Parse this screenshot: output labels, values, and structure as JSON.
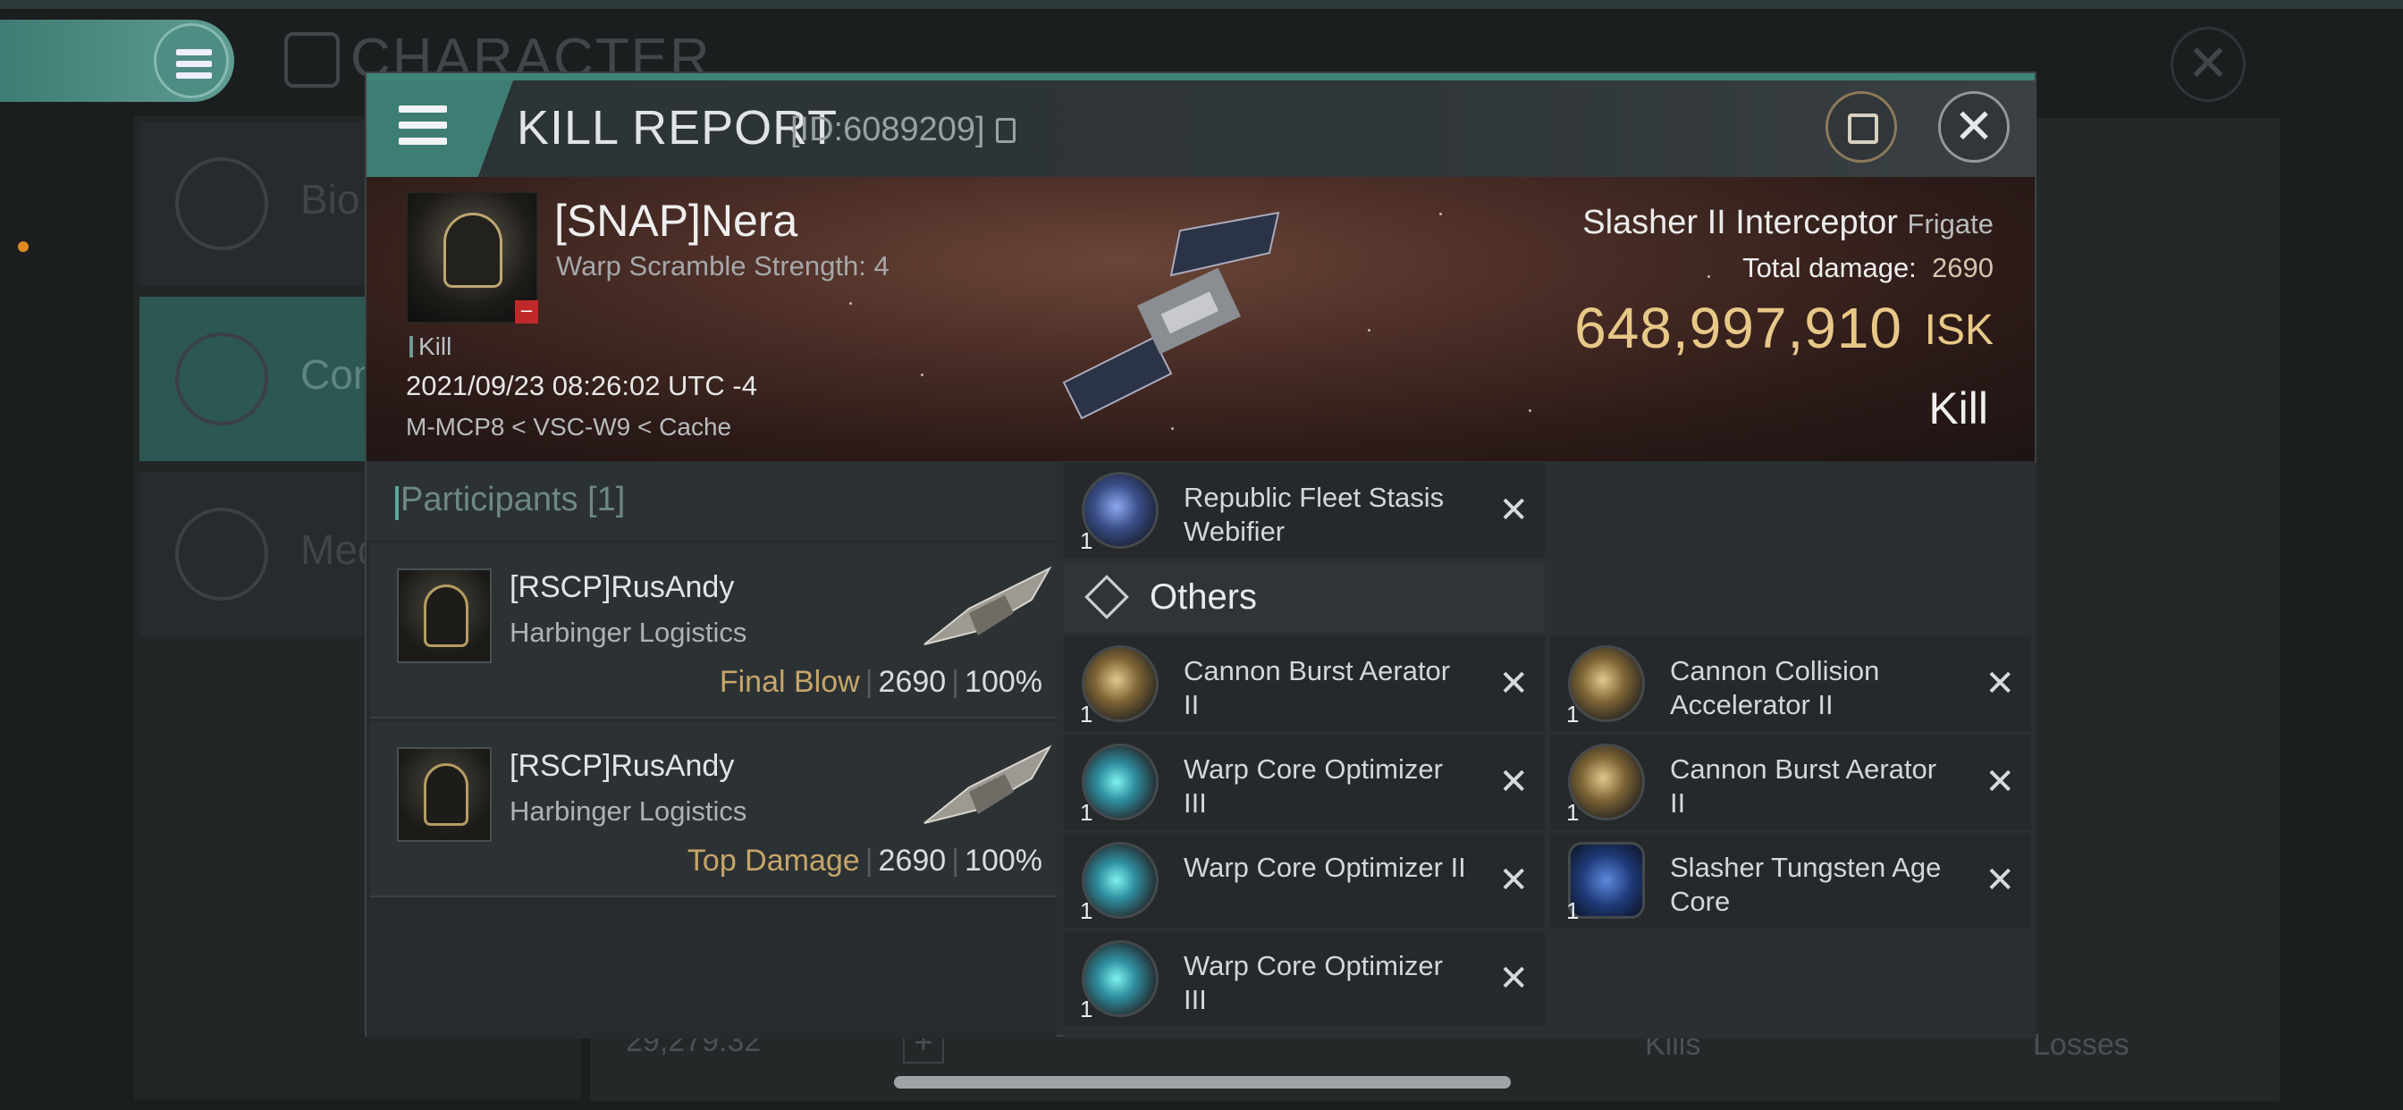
{
  "background": {
    "title": "CHARACTER",
    "left_items": [
      {
        "label": "Bio"
      },
      {
        "label": "Con"
      },
      {
        "label": "Med"
      }
    ],
    "isk_value": "29,279.32",
    "kills_label": "Kills",
    "losses_label": "Losses"
  },
  "window": {
    "title": "KILL REPORT",
    "id": "[ID:6089209]"
  },
  "victim": {
    "name": "[SNAP]Nera",
    "subtitle": "Warp Scramble Strength: 4",
    "tag": "Kill",
    "datetime": "2021/09/23 08:26:02 UTC -4",
    "location": "M-MCP8 < VSC-W9 < Cache",
    "ship": "Slasher II Interceptor",
    "ship_class": "Frigate",
    "total_damage_label": "Total damage:",
    "total_damage": "2690",
    "isk_value": "648,997,910",
    "isk_unit": "ISK",
    "result": "Kill"
  },
  "participants": {
    "header": "Participants [1]",
    "rows": [
      {
        "name": "[RSCP]RusAndy",
        "ship": "Harbinger Logistics",
        "tag": "Final Blow",
        "damage": "2690",
        "percent": "100%"
      },
      {
        "name": "[RSCP]RusAndy",
        "ship": "Harbinger Logistics",
        "tag": "Top Damage",
        "damage": "2690",
        "percent": "100%"
      }
    ]
  },
  "items": {
    "top": {
      "qty": "1",
      "name": "Republic Fleet Stasis Webifier",
      "icon": "webifier-icon"
    },
    "others_header": "Others",
    "list": [
      {
        "qty": "1",
        "name": "Cannon Burst Aerator II",
        "icon": "rig-icon"
      },
      {
        "qty": "1",
        "name": "Cannon Collision Accelerator II",
        "icon": "rig-icon"
      },
      {
        "qty": "1",
        "name": "Warp Core Optimizer III",
        "icon": "warp-core-icon"
      },
      {
        "qty": "1",
        "name": "Cannon Burst Aerator II",
        "icon": "rig-icon"
      },
      {
        "qty": "1",
        "name": "Warp Core Optimizer II",
        "icon": "warp-core-icon"
      },
      {
        "qty": "1",
        "name": "Slasher Tungsten Age Core",
        "icon": "core-icon"
      },
      {
        "qty": "1",
        "name": "Warp Core Optimizer III",
        "icon": "warp-core-icon"
      }
    ],
    "remove_glyph": "✕"
  },
  "colors": {
    "accent": "#3e7d73",
    "isk": "#e8c887",
    "tag_gold": "#c7a569"
  }
}
